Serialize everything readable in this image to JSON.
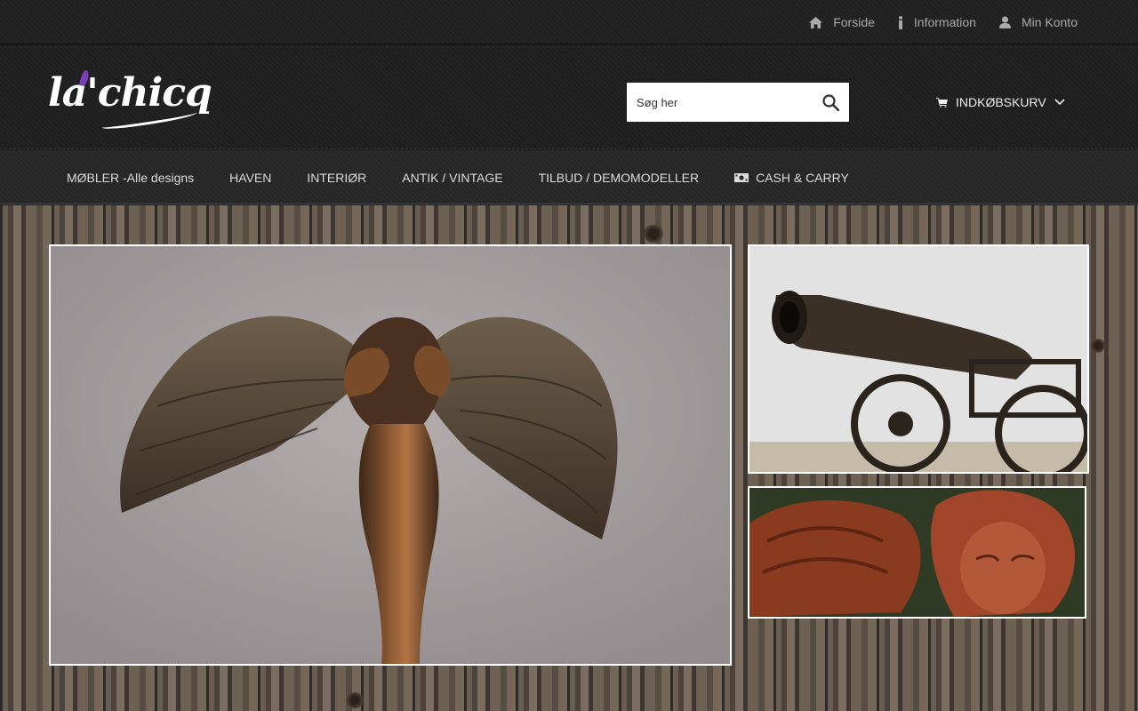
{
  "topnav": {
    "items": [
      {
        "label": "Forside",
        "icon": "home-icon"
      },
      {
        "label": "Information",
        "icon": "info-icon"
      },
      {
        "label": "Min Konto",
        "icon": "user-icon"
      }
    ]
  },
  "header": {
    "logo_text": "la'chicq",
    "search_placeholder": "Søg her",
    "cart_label": "INDKØBSKURV"
  },
  "mainnav": {
    "items": [
      {
        "label": "MØBLER -Alle designs"
      },
      {
        "label": "HAVEN"
      },
      {
        "label": "INTERIØR"
      },
      {
        "label": "ANTIK / VINTAGE"
      },
      {
        "label": "TILBUD / DEMOMODELLER"
      },
      {
        "label": "CASH & CARRY",
        "icon": "money-icon"
      }
    ]
  },
  "colors": {
    "logo_accent": "#7a3fb8",
    "bar_background": "#222222",
    "nav_text": "#dcdcdc"
  }
}
